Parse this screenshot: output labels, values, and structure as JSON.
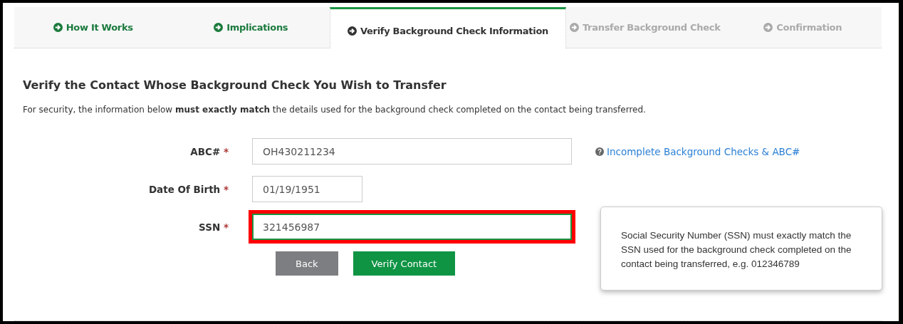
{
  "tabs": [
    {
      "label": "How It Works",
      "selected": false,
      "disabled": false
    },
    {
      "label": "Implications",
      "selected": false,
      "disabled": false
    },
    {
      "label": "Verify Background Check Information",
      "selected": true,
      "disabled": false
    },
    {
      "label": "Transfer Background Check",
      "selected": false,
      "disabled": true
    },
    {
      "label": "Confirmation",
      "selected": false,
      "disabled": true
    }
  ],
  "heading": "Verify the Contact Whose Background Check You Wish to Transfer",
  "intro": "For security, the information below **must exactly match** the details used for the background check completed on the contact being transferred.",
  "fields": [
    {
      "label": "ABC#",
      "required_mark": "*",
      "value": "OH430211234",
      "kind": "text",
      "highlighted": false,
      "help_link": "Incomplete Background Checks & ABC#"
    },
    {
      "label": "Date Of Birth",
      "required_mark": "*",
      "value": "01/19/1951",
      "kind": "date",
      "highlighted": false
    },
    {
      "label": "SSN",
      "required_mark": "*",
      "value": "321456987",
      "kind": "text",
      "highlighted": true
    }
  ],
  "buttons": [
    {
      "label": "Back",
      "kind": "secondary"
    },
    {
      "label": "Verify Contact",
      "kind": "primary"
    }
  ],
  "tooltip": "Social Security Number (SSN) must exactly match the SSN used for the background check completed on the contact being transferred, e.g. 012346789"
}
